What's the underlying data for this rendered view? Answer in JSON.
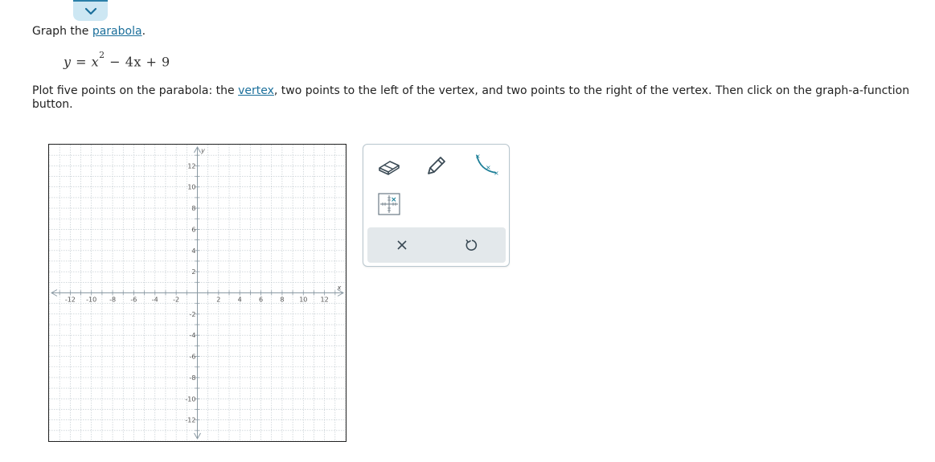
{
  "collapse_tab": {
    "icon": "chevron-down-icon"
  },
  "prompt": {
    "prefix": "Graph the ",
    "link": "parabola",
    "suffix": "."
  },
  "equation": {
    "lhs": "y",
    "eq": " = ",
    "base": "x",
    "exp": "2",
    "rest": " − 4x + 9"
  },
  "instructions": {
    "part1": "Plot five points on the parabola: the ",
    "link": "vertex",
    "part2": ", two points to the left of the vertex, and two points to the right of the vertex. Then click on the graph-a-function button."
  },
  "graph": {
    "x_axis_label": "x",
    "y_axis_label": "y",
    "x_range": [
      -14,
      14
    ],
    "y_range": [
      -14,
      14
    ],
    "grid_step": 1,
    "x_tick_labels": [
      "-12",
      "-10",
      "-8",
      "-6",
      "-4",
      "-2",
      "2",
      "4",
      "6",
      "8",
      "10",
      "12"
    ],
    "y_tick_labels": [
      "12",
      "10",
      "8",
      "6",
      "4",
      "2",
      "-2",
      "-4",
      "-6",
      "-8",
      "-10",
      "-12"
    ],
    "grid_color": "#b9c3c9",
    "axis_color": "#8a99a3"
  },
  "tools": {
    "eraser": "eraser-icon",
    "pencil": "pencil-icon",
    "graph_function": "graph-a-function-icon",
    "move_points": "grid-points-icon",
    "clear": "close-icon",
    "undo": "undo-icon"
  },
  "colors": {
    "accent": "#1b6f9b",
    "tab_bg": "#cde7f3",
    "toolbar_bg": "#e3e8eb"
  }
}
